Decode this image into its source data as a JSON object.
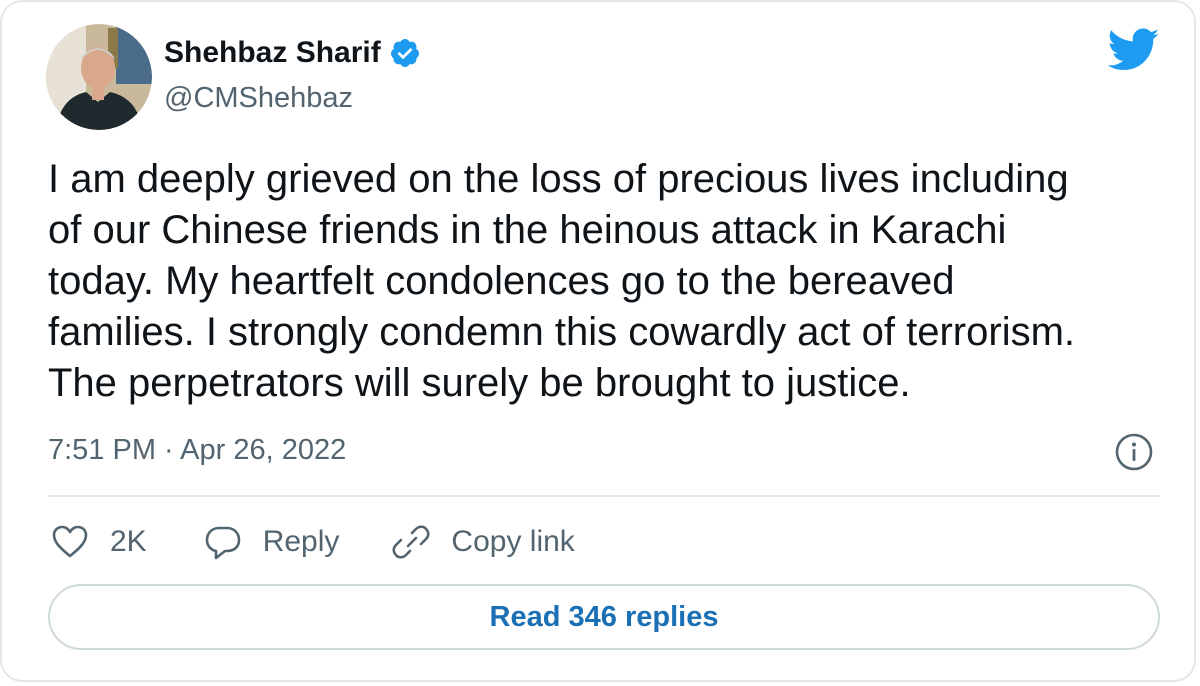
{
  "author": {
    "name": "Shehbaz Sharif",
    "handle": "@CMShehbaz",
    "verified": true
  },
  "tweet": {
    "text": "I am deeply grieved on the loss of precious lives including\nof our Chinese friends in the heinous attack in Karachi\ntoday. My heartfelt condolences go to the bereaved\nfamilies. I strongly condemn this cowardly act of terrorism.\nThe perpetrators will surely be brought to justice.",
    "timestamp": "7:51 PM · Apr 26, 2022"
  },
  "actions": {
    "like_count": "2K",
    "reply_label": "Reply",
    "copy_link_label": "Copy link"
  },
  "read_replies_label": "Read 346 replies",
  "icons": {
    "brand": "twitter-bird-icon",
    "verified": "verified-badge-icon",
    "info": "info-icon",
    "like": "heart-icon",
    "reply": "speech-bubble-icon",
    "copy_link": "link-icon"
  },
  "colors": {
    "brand_blue": "#1d9bf0",
    "link_blue": "#1b6fb5",
    "secondary_text": "#536471",
    "border": "#e1e8ed"
  }
}
